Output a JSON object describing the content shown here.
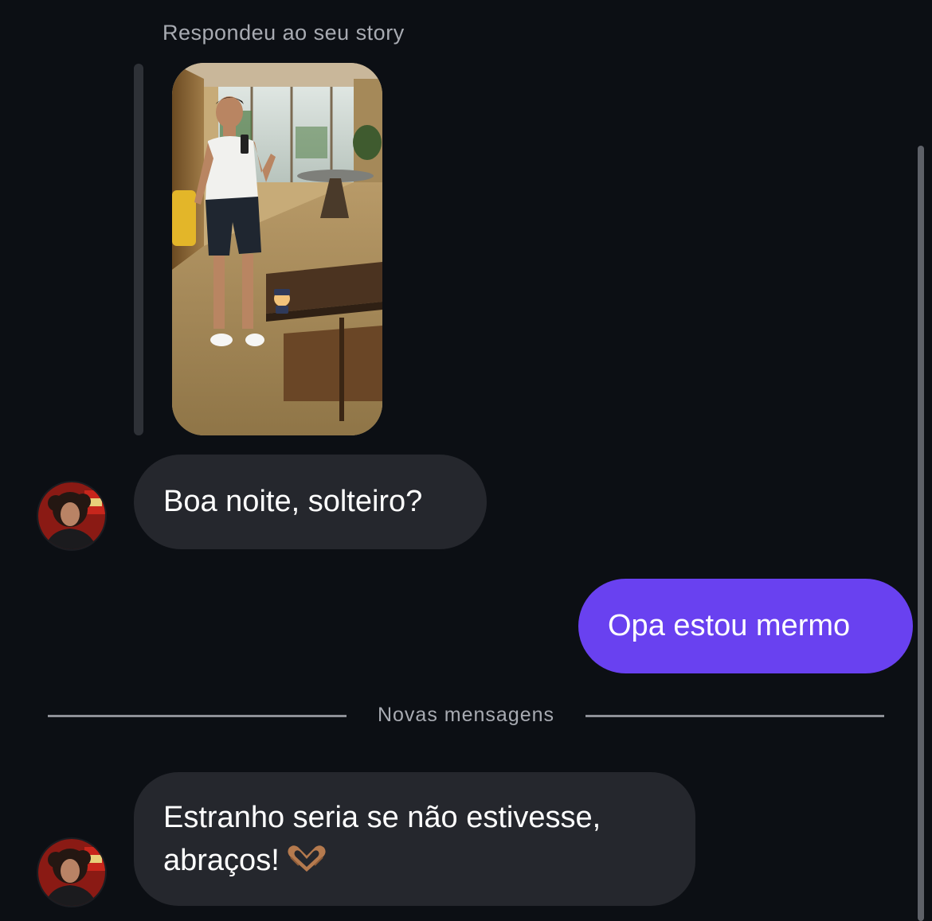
{
  "story_reply": {
    "caption": "Respondeu ao seu story",
    "sticker_icon": "police-officer-emoji"
  },
  "messages": [
    {
      "direction": "incoming",
      "text": "Boa noite, solteiro?"
    },
    {
      "direction": "outgoing",
      "text": "Opa estou mermo"
    },
    {
      "direction": "incoming",
      "line1": "Estranho seria se não estivesse,",
      "line2": "abraços!",
      "emoji": "heart-hands-emoji"
    }
  ],
  "divider": {
    "label": "Novas mensagens"
  },
  "colors": {
    "background": "#0c0f14",
    "incoming_bubble": "#25272d",
    "outgoing_bubble": "#6941f0",
    "secondary_text": "#a8abb2"
  }
}
